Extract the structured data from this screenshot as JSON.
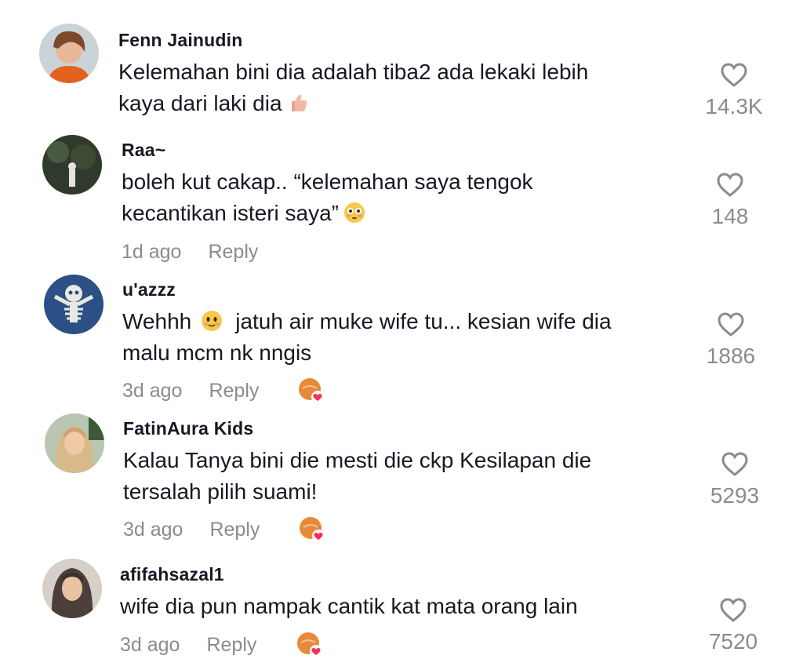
{
  "comments": [
    {
      "username": "Fenn Jainudin",
      "line1": "Kelemahan bini dia adalah tiba2 ada lekaki lebih",
      "line2": "kaya dari laki dia",
      "emoji": "thumbs-up",
      "likes": "14.3K"
    },
    {
      "username": "Raa~",
      "line1": "boleh kut cakap.. “kelemahan saya tengok",
      "line2": "kecantikan isteri saya”",
      "emoji": "flushed-face",
      "time": "1d ago",
      "reply": "Reply",
      "likes": "148"
    },
    {
      "username": "u'azzz",
      "line1": "Wehhh",
      "line1b": "jatuh air muke wife tu... kesian wife dia",
      "line2": "malu mcm nk nngis",
      "emoji": "smiling-face",
      "time": "3d ago",
      "reply": "Reply",
      "likes": "1886"
    },
    {
      "username": "FatinAura Kids",
      "line1": "Kalau Tanya bini die mesti die ckp Kesilapan die",
      "line2": "tersalah pilih suami!",
      "time": "3d ago",
      "reply": "Reply",
      "likes": "5293"
    },
    {
      "username": "afifahsazal1",
      "line1": "wife dia pun nampak cantik kat mata orang lain",
      "time": "3d ago",
      "reply": "Reply",
      "likes": "7520"
    }
  ],
  "colors": {
    "primary_text": "#161823",
    "secondary_text": "#8a8b91",
    "creator_badge": "#e8893a",
    "creator_heart": "#fe2c55"
  },
  "icons": {
    "like": "heart-outline-icon",
    "creator_liked": "creator-liked-badge-icon"
  }
}
